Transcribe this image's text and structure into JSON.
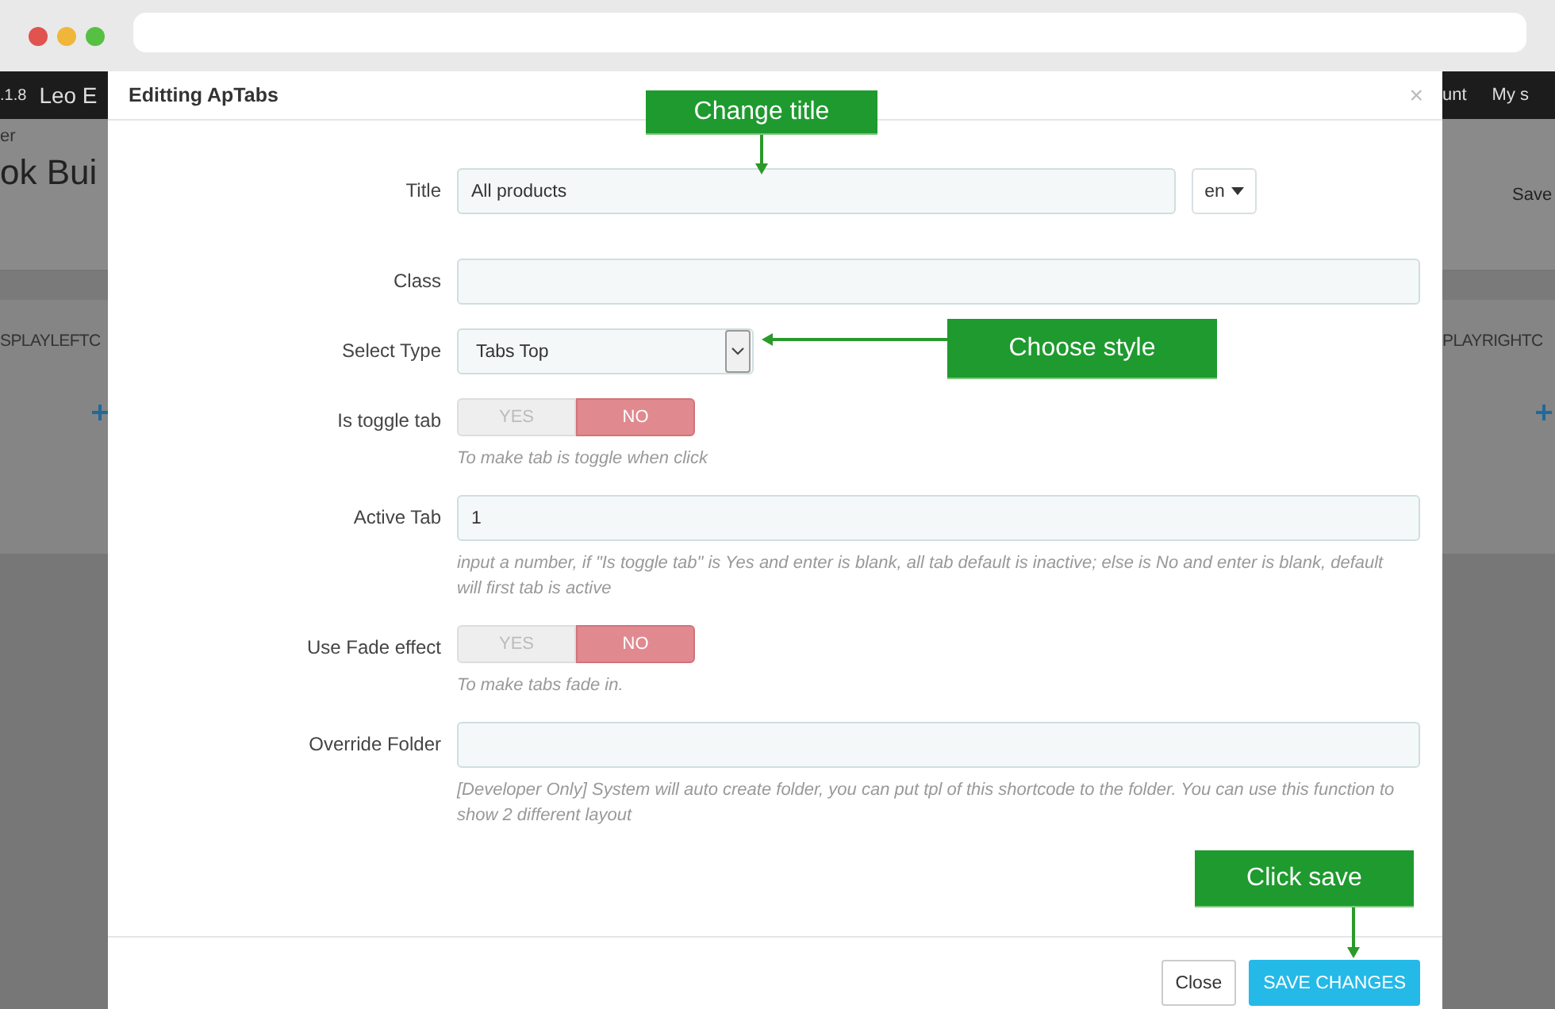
{
  "window_controls": [
    {
      "color": "#e0534f"
    },
    {
      "color": "#f0b63a"
    },
    {
      "color": "#56c043"
    }
  ],
  "background_page": {
    "nav_left": [
      ".1.8",
      "Leo E"
    ],
    "nav_right": [
      "unt",
      "My s"
    ],
    "breadcrumb": "er",
    "heading": "ok Bui",
    "save_label": "Save",
    "left_column": "SPLAYLEFTC",
    "right_column": "PLAYRIGHTC"
  },
  "modal": {
    "title": "Editting ApTabs",
    "close": "×",
    "fields": [
      {
        "kind": "text",
        "label": "Title",
        "value": "All products",
        "language": "en"
      },
      {
        "kind": "text",
        "label": "Class"
      },
      {
        "kind": "select",
        "label": "Select Type",
        "value": "Tabs Top"
      },
      {
        "kind": "toggle",
        "label": "Is toggle tab",
        "options": [
          {
            "label": "YES",
            "selected": false
          },
          {
            "label": "NO",
            "selected": true
          }
        ],
        "help": "To make tab is toggle when click"
      },
      {
        "kind": "text",
        "label": "Active Tab",
        "value": "1",
        "help": "input a number, if \"Is toggle tab\" is Yes and enter is blank, all tab default is inactive; else is No and enter is blank, default will first tab is active"
      },
      {
        "kind": "toggle",
        "label": "Use Fade effect",
        "options": [
          {
            "label": "YES",
            "selected": false
          },
          {
            "label": "NO",
            "selected": true
          }
        ],
        "help": "To make tabs fade in."
      },
      {
        "kind": "text",
        "label": "Override Folder",
        "help": "[Developer Only] System will auto create folder, you can put tpl of this shortcode to the folder. You can use this function to show 2 different layout"
      }
    ],
    "buttons": [
      {
        "kind": "default",
        "label": "Close"
      },
      {
        "kind": "primary",
        "label": "SAVE CHANGES"
      }
    ]
  },
  "annotations": [
    {
      "text": "Change title",
      "kind": "down"
    },
    {
      "text": "Choose style",
      "kind": "left"
    },
    {
      "text": "Click save",
      "kind": "down"
    }
  ]
}
